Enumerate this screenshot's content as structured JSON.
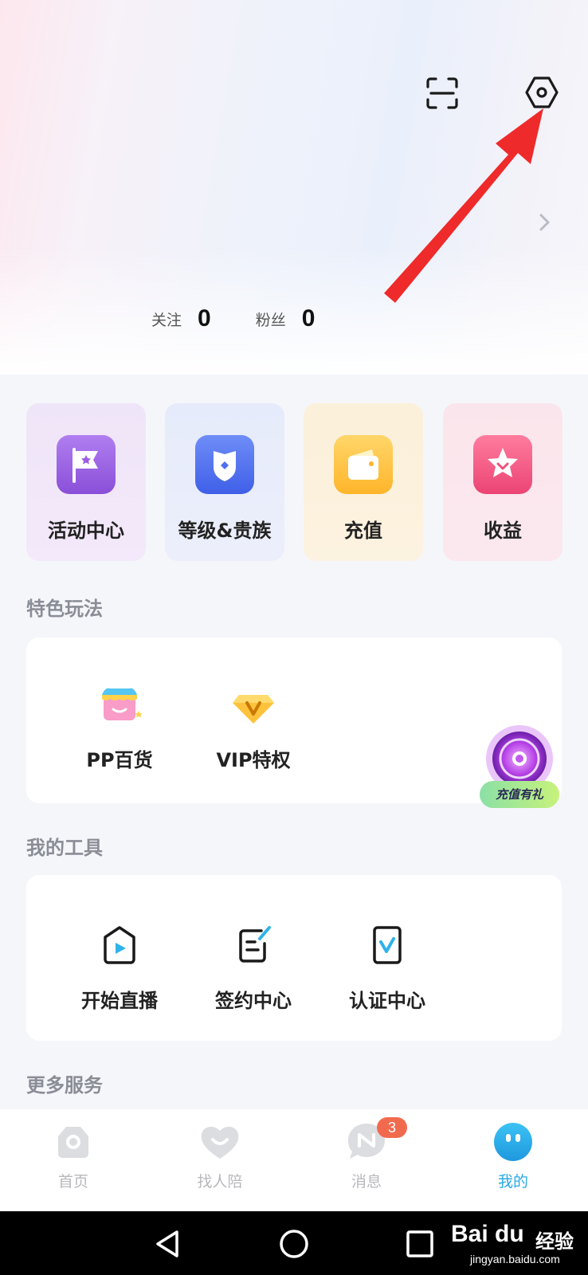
{
  "profile": {
    "following_label": "关注",
    "following_count": "0",
    "fans_label": "粉丝",
    "fans_count": "0"
  },
  "quick_actions": [
    {
      "label": "活动中心",
      "icon": "flag-icon",
      "color": "#9b5fe0"
    },
    {
      "label": "等级&贵族",
      "icon": "shield-icon",
      "color": "#4d6ff0"
    },
    {
      "label": "充值",
      "icon": "wallet-icon",
      "color": "#ffc13d"
    },
    {
      "label": "收益",
      "icon": "star-icon",
      "color": "#f0507c"
    }
  ],
  "features": {
    "title": "特色玩法",
    "items": [
      {
        "label": "PP百货",
        "icon": "shop-icon"
      },
      {
        "label": "VIP特权",
        "icon": "vip-diamond-icon"
      }
    ]
  },
  "promo": {
    "label": "充值有礼"
  },
  "tools": {
    "title": "我的工具",
    "items": [
      {
        "label": "开始直播",
        "icon": "live-play-icon"
      },
      {
        "label": "签约中心",
        "icon": "contract-icon"
      },
      {
        "label": "认证中心",
        "icon": "verify-icon"
      }
    ]
  },
  "more_services": {
    "title": "更多服务"
  },
  "tabbar": {
    "items": [
      {
        "label": "首页",
        "icon": "home-icon"
      },
      {
        "label": "找人陪",
        "icon": "heart-icon"
      },
      {
        "label": "消息",
        "icon": "message-icon",
        "badge": "3"
      },
      {
        "label": "我的",
        "icon": "me-icon",
        "active_color": "#28a9e6"
      }
    ]
  },
  "watermark": {
    "logo": "Bai du",
    "text": "经验",
    "sub": "jingyan.baidu.com"
  }
}
